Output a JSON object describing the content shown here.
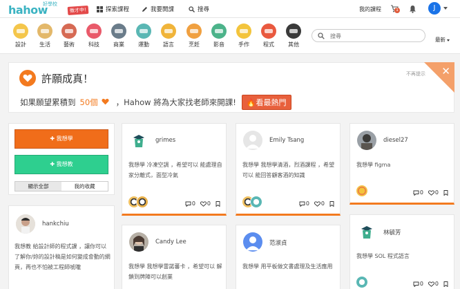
{
  "nav": {
    "logo_main": "hahow",
    "logo_sub": "好學校",
    "logo_badge": "徵才中!",
    "explore": "探索課程",
    "teach": "我要開課",
    "search": "搜尋",
    "my_courses": "我的課程",
    "cart_count": "1",
    "avatar_letter": "J"
  },
  "categories": [
    {
      "label": "設計",
      "color": "#f4c64b"
    },
    {
      "label": "生活",
      "color": "#e3b86a"
    },
    {
      "label": "藝術",
      "color": "#d66a54"
    },
    {
      "label": "科技",
      "color": "#e95a6a"
    },
    {
      "label": "商業",
      "color": "#6a7c8a"
    },
    {
      "label": "運動",
      "color": "#5ab7b4"
    },
    {
      "label": "語言",
      "color": "#f0b43a"
    },
    {
      "label": "烹飪",
      "color": "#f0a040"
    },
    {
      "label": "影音",
      "color": "#4cb38a"
    },
    {
      "label": "手作",
      "color": "#f3c43c"
    },
    {
      "label": "程式",
      "color": "#e9593f"
    },
    {
      "label": "其他",
      "color": "#3a3a3a"
    }
  ],
  "search_placeholder": "搜尋",
  "sort_label": "最新",
  "banner": {
    "title": "許願成真！",
    "text_before": "如果願望累積到",
    "count": "50個",
    "text_after": "，Hahow 將為大家找老師來開課!",
    "hot_button": "看最熱門",
    "dismiss": "不再提示"
  },
  "left": {
    "learn_button": "✚ 我想學",
    "teach_button": "✚ 我想教",
    "tab_all": "顯示全部",
    "tab_fav": "我的收藏"
  },
  "left_card": {
    "name": "hankchiu",
    "text": "我想教 給設計師的程式課 ，讓你可以了解你/妳的設計稿是如何變成會動的網頁，再也不怕被工程師唬嚨"
  },
  "cards": [
    {
      "name": "grimes",
      "text": "我想學 冷凍空調 ，希望可以 能處理自家分離式，面型冷氣",
      "comments": "0",
      "likes": "0"
    },
    {
      "name": "Emily Tsang",
      "text": "我想學 我想學清酒，烈酒課程 ，希望可以 能回答顧客酒的知識",
      "comments": "0",
      "likes": "0"
    },
    {
      "name": "diesel27",
      "text": "我想學 figma",
      "comments": "0",
      "likes": "0"
    },
    {
      "name": "Candy Lee",
      "text": "我想學 我想學雷諾蕃卡 ，希望可以 解鎖到牌陣可以創業",
      "comments": "",
      "likes": ""
    },
    {
      "name": "范淑貞",
      "text": "我想學 用平板做文書處理及生活應用",
      "comments": "",
      "likes": ""
    },
    {
      "name": "林毓芳",
      "text": "我想學 SOL 程式語言",
      "comments": "0",
      "likes": "0"
    }
  ]
}
